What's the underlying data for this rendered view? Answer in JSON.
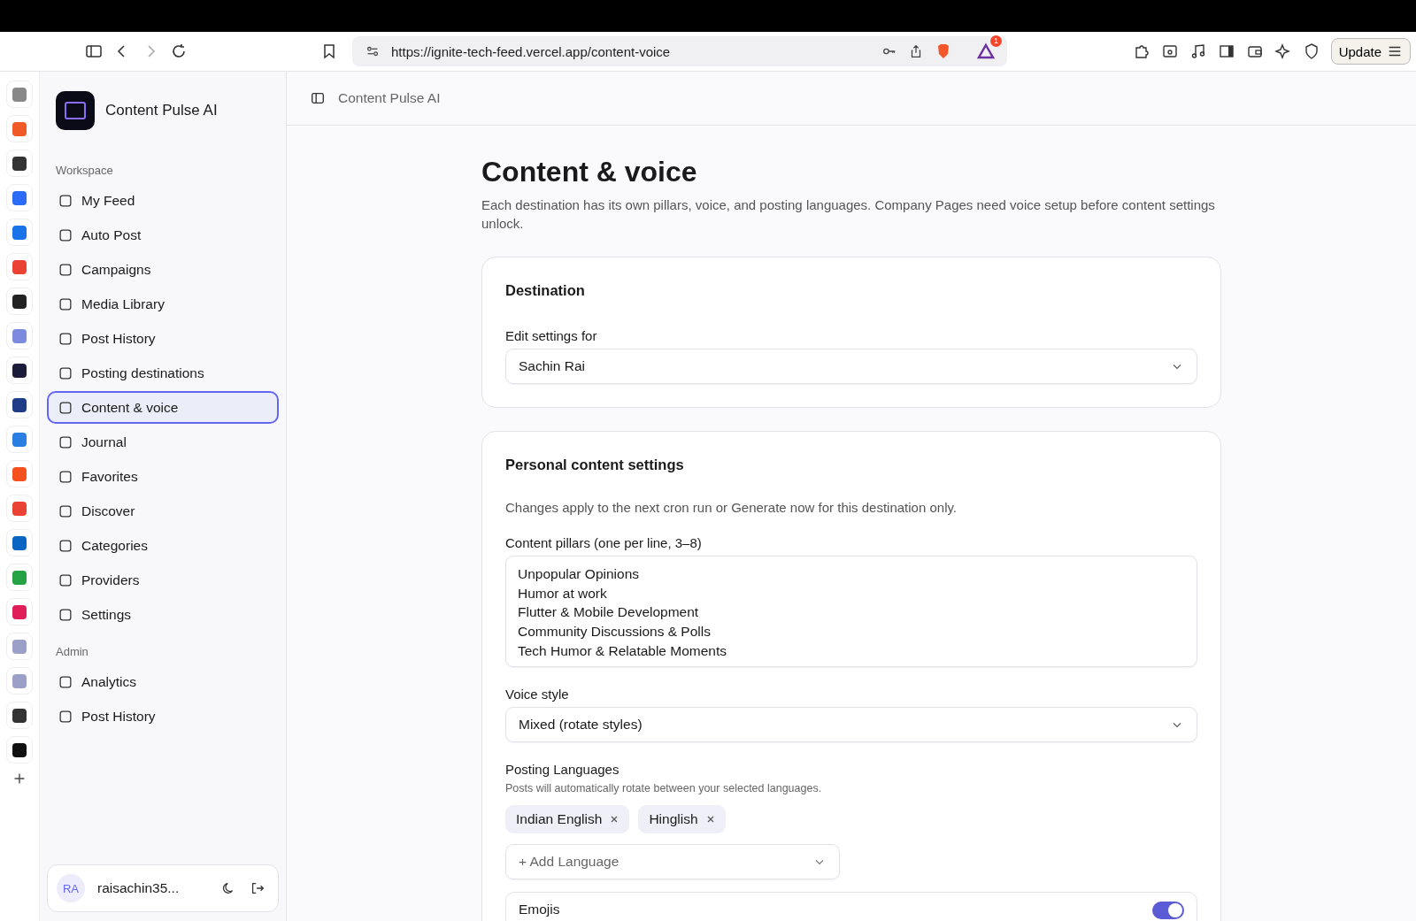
{
  "browser": {
    "url": "https://ignite-tech-feed.vercel.app/content-voice",
    "notification_count": "1",
    "update_label": "Update"
  },
  "sidebar": {
    "app_name": "Content Pulse AI",
    "sections": [
      {
        "title": "Workspace",
        "items": [
          {
            "label": "My Feed",
            "selected": false
          },
          {
            "label": "Auto Post",
            "selected": false
          },
          {
            "label": "Campaigns",
            "selected": false
          },
          {
            "label": "Media Library",
            "selected": false
          },
          {
            "label": "Post History",
            "selected": false
          },
          {
            "label": "Posting destinations",
            "selected": false
          },
          {
            "label": "Content & voice",
            "selected": true
          },
          {
            "label": "Journal",
            "selected": false
          },
          {
            "label": "Favorites",
            "selected": false
          },
          {
            "label": "Discover",
            "selected": false
          },
          {
            "label": "Categories",
            "selected": false
          },
          {
            "label": "Providers",
            "selected": false
          },
          {
            "label": "Settings",
            "selected": false
          }
        ]
      },
      {
        "title": "Admin",
        "items": [
          {
            "label": "Analytics",
            "selected": false
          },
          {
            "label": "Post History",
            "selected": false
          }
        ]
      }
    ],
    "user": {
      "initials": "RA",
      "name": "raisachin35..."
    }
  },
  "header": {
    "breadcrumb": "Content Pulse AI"
  },
  "page": {
    "title": "Content & voice",
    "description": "Each destination has its own pillars, voice, and posting languages. Company Pages need voice setup before content settings unlock."
  },
  "destination_card": {
    "title": "Destination",
    "field_label": "Edit settings for",
    "value": "Sachin Rai"
  },
  "settings_card": {
    "title": "Personal content settings",
    "note": "Changes apply to the next cron run or Generate now for this destination only.",
    "pillars_label": "Content pillars (one per line, 3–8)",
    "pillars": [
      "Unpopular Opinions",
      "Humor at work",
      "Flutter & Mobile Development",
      "Community Discussions & Polls",
      "Tech Humor & Relatable Moments"
    ],
    "voice_label": "Voice style",
    "voice_value": "Mixed (rotate styles)",
    "languages_label": "Posting Languages",
    "languages_hint": "Posts will automatically rotate between your selected languages.",
    "languages": [
      "Indian English",
      "Hinglish"
    ],
    "add_language_placeholder": "+ Add Language",
    "emojis": {
      "label": "Emojis",
      "on": true
    }
  }
}
